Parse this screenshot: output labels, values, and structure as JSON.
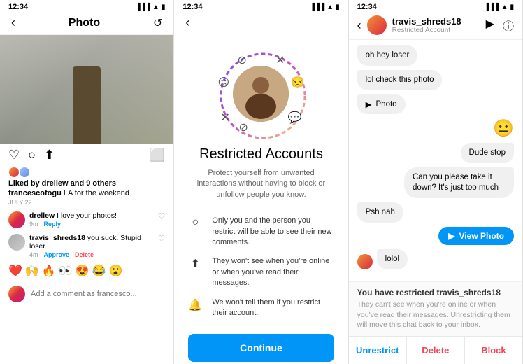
{
  "panel1": {
    "status_time": "12:34",
    "title": "Photo",
    "likes": "Liked by drellew and 9 others",
    "caption_user": "francescofogu",
    "caption_text": " LA for the weekend",
    "date": "JULY 22",
    "comment1_user": "drellew",
    "comment1_text": " I love your photos!",
    "comment1_time": "9m",
    "comment1_reply": "Reply",
    "comment2_user": "travis_shreds18",
    "comment2_text": " you suck. Stupid loser",
    "comment2_time": "4m",
    "comment2_approve": "Approve",
    "comment2_delete": "Delete",
    "comment_placeholder": "Add a comment as francesco..."
  },
  "panel2": {
    "status_time": "12:34",
    "title": "Restricted Accounts",
    "subtitle": "Protect yourself from unwanted interactions without having to block or unfollow people you know.",
    "feature1": "Only you and the person you restrict will be able to see their new comments.",
    "feature2": "They won't see when you're online or when you've read their messages.",
    "feature3": "We won't tell them if you restrict their account.",
    "continue_label": "Continue"
  },
  "panel3": {
    "status_time": "12:34",
    "username": "travis_shreds18",
    "status": "Restricted Account",
    "msg1": "oh hey loser",
    "msg2": "lol check this photo",
    "msg3": "Photo",
    "msg4": "😐",
    "msg5": "Dude stop",
    "msg6": "Can you please take it down? It's just too much",
    "msg7": "Psh nah",
    "msg8": "View Photo",
    "msg9": "lolol",
    "restricted_title": "You have restricted travis_shreds18",
    "restricted_text": "They can't see when you're online or when you've read their messages. Unrestricting them will move this chat back to your inbox.",
    "btn_unrestrict": "Unrestrict",
    "btn_delete": "Delete",
    "btn_block": "Block"
  }
}
